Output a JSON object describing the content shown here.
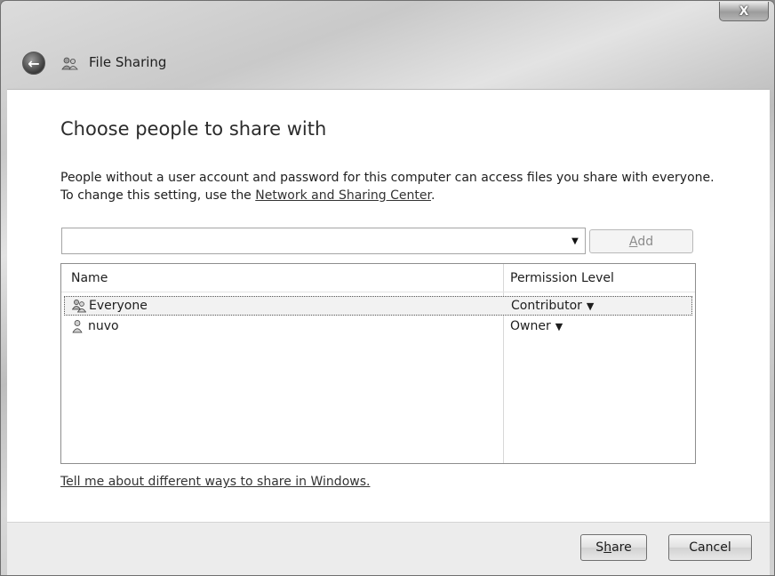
{
  "window": {
    "title": "File Sharing",
    "close_glyph": "X"
  },
  "main": {
    "heading": "Choose people to share with",
    "description_line1": "People without a user account and password for this computer can access files you share with everyone.",
    "description_line2_prefix": "To change this setting, use the ",
    "network_link": "Network and Sharing Center",
    "description_line2_suffix": ".",
    "combo_value": "",
    "add_button": {
      "mnemonic": "A",
      "rest": "dd"
    },
    "columns": [
      "Name",
      "Permission Level"
    ],
    "rows": [
      {
        "name": "Everyone",
        "permission": "Contributor",
        "icon": "user-group-icon",
        "selected": true
      },
      {
        "name": "nuvo",
        "permission": "Owner",
        "icon": "user-icon",
        "selected": false
      }
    ],
    "learn_link": "Tell me about different ways to share in Windows."
  },
  "footer": {
    "share_button": {
      "before": "S",
      "mnemonic": "h",
      "after": "are"
    },
    "cancel_button": "Cancel"
  }
}
